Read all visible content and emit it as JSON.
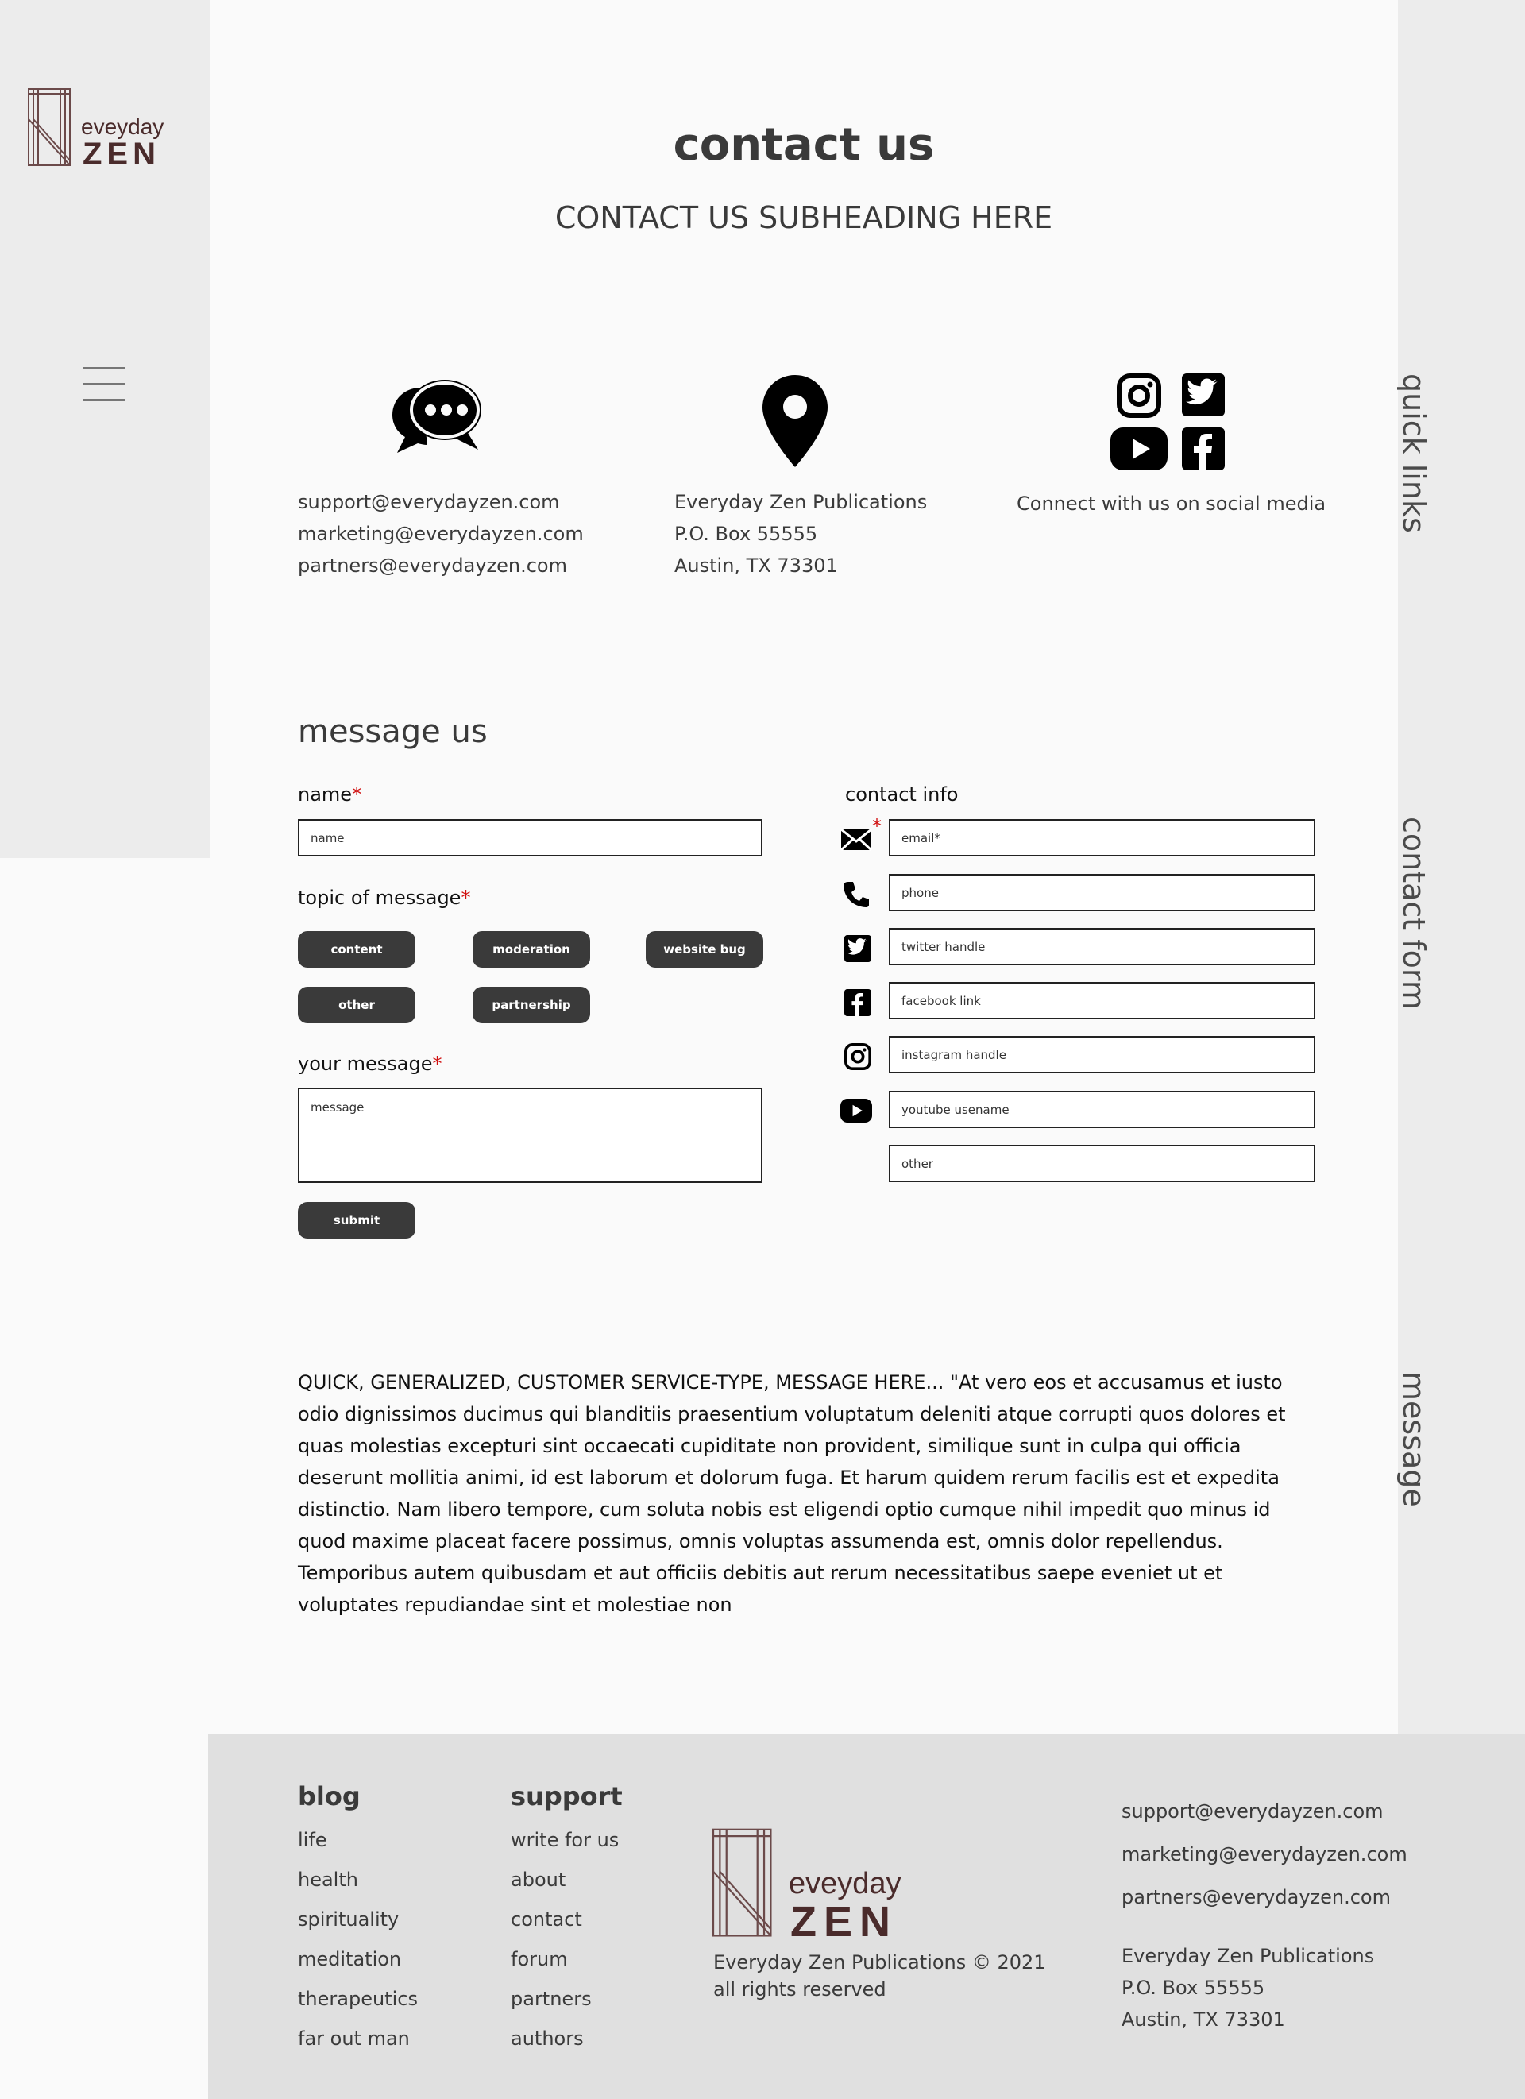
{
  "brand": {
    "word_top": "eveyday",
    "word_bottom": "ZEN",
    "color": "#4a2b2b"
  },
  "right_tabs": {
    "quick_links": "quick links",
    "contact_form": "contact form",
    "message": "message"
  },
  "header": {
    "title": "contact us",
    "subheading": "CONTACT US SUBHEADING HERE"
  },
  "info": {
    "emails": [
      "support@everydayzen.com",
      "marketing@everydayzen.com",
      "partners@everydayzen.com"
    ],
    "address": [
      "Everyday Zen Publications",
      "P.O. Box 55555",
      "Austin, TX 73301"
    ],
    "social_text": "Connect with us on social media"
  },
  "form": {
    "title": "message us",
    "name_label": "name",
    "name_placeholder": "name",
    "topic_label": "topic of message",
    "topics": [
      "content",
      "moderation",
      "website bug",
      "other",
      "partnership"
    ],
    "message_label": "your message",
    "message_placeholder": "message",
    "submit_label": "submit",
    "required_mark": "*",
    "contact_label": "contact info",
    "contact_fields": {
      "email": "email*",
      "phone": "phone",
      "twitter": "twitter handle",
      "facebook": "facebook link",
      "instagram": "instagram handle",
      "youtube": "youtube usename",
      "other": "other"
    }
  },
  "generic_message": "QUICK, GENERALIZED, CUSTOMER SERVICE-TYPE, MESSAGE HERE... \"At vero eos et accusamus et iusto odio dignissimos ducimus qui blanditiis praesentium voluptatum deleniti atque corrupti quos dolores et quas molestias excepturi sint occaecati cupiditate non provident, similique sunt in culpa qui officia deserunt mollitia animi, id est laborum et dolorum fuga. Et harum quidem rerum facilis est et expedita distinctio. Nam libero tempore, cum soluta nobis est eligendi optio cumque nihil impedit quo minus id quod maxime placeat facere possimus, omnis voluptas assumenda est, omnis dolor repellendus. Temporibus autem quibusdam et aut officiis debitis aut rerum necessitatibus saepe eveniet ut et voluptates repudiandae sint et molestiae non",
  "footer": {
    "blog": {
      "heading": "blog",
      "links": [
        "life",
        "health",
        "spirituality",
        "meditation",
        "therapeutics",
        "far out man"
      ]
    },
    "support": {
      "heading": "support",
      "links": [
        "write for us",
        "about",
        "contact",
        "forum",
        "partners",
        "authors"
      ]
    },
    "copyright": "Everyday Zen Publications © 2021",
    "rights": "all rights reserved",
    "emails": [
      "support@everydayzen.com",
      "marketing@everydayzen.com",
      "partners@everydayzen.com"
    ],
    "address": [
      "Everyday Zen Publications",
      "P.O. Box 55555",
      "Austin, TX 73301"
    ]
  },
  "icons": {
    "menu": "hamburger-menu-icon",
    "chat": "chat-bubbles-icon",
    "location": "location-pin-icon",
    "instagram": "instagram-icon",
    "twitter": "twitter-icon",
    "youtube": "youtube-icon",
    "facebook": "facebook-icon",
    "email": "envelope-icon",
    "phone": "phone-icon"
  }
}
